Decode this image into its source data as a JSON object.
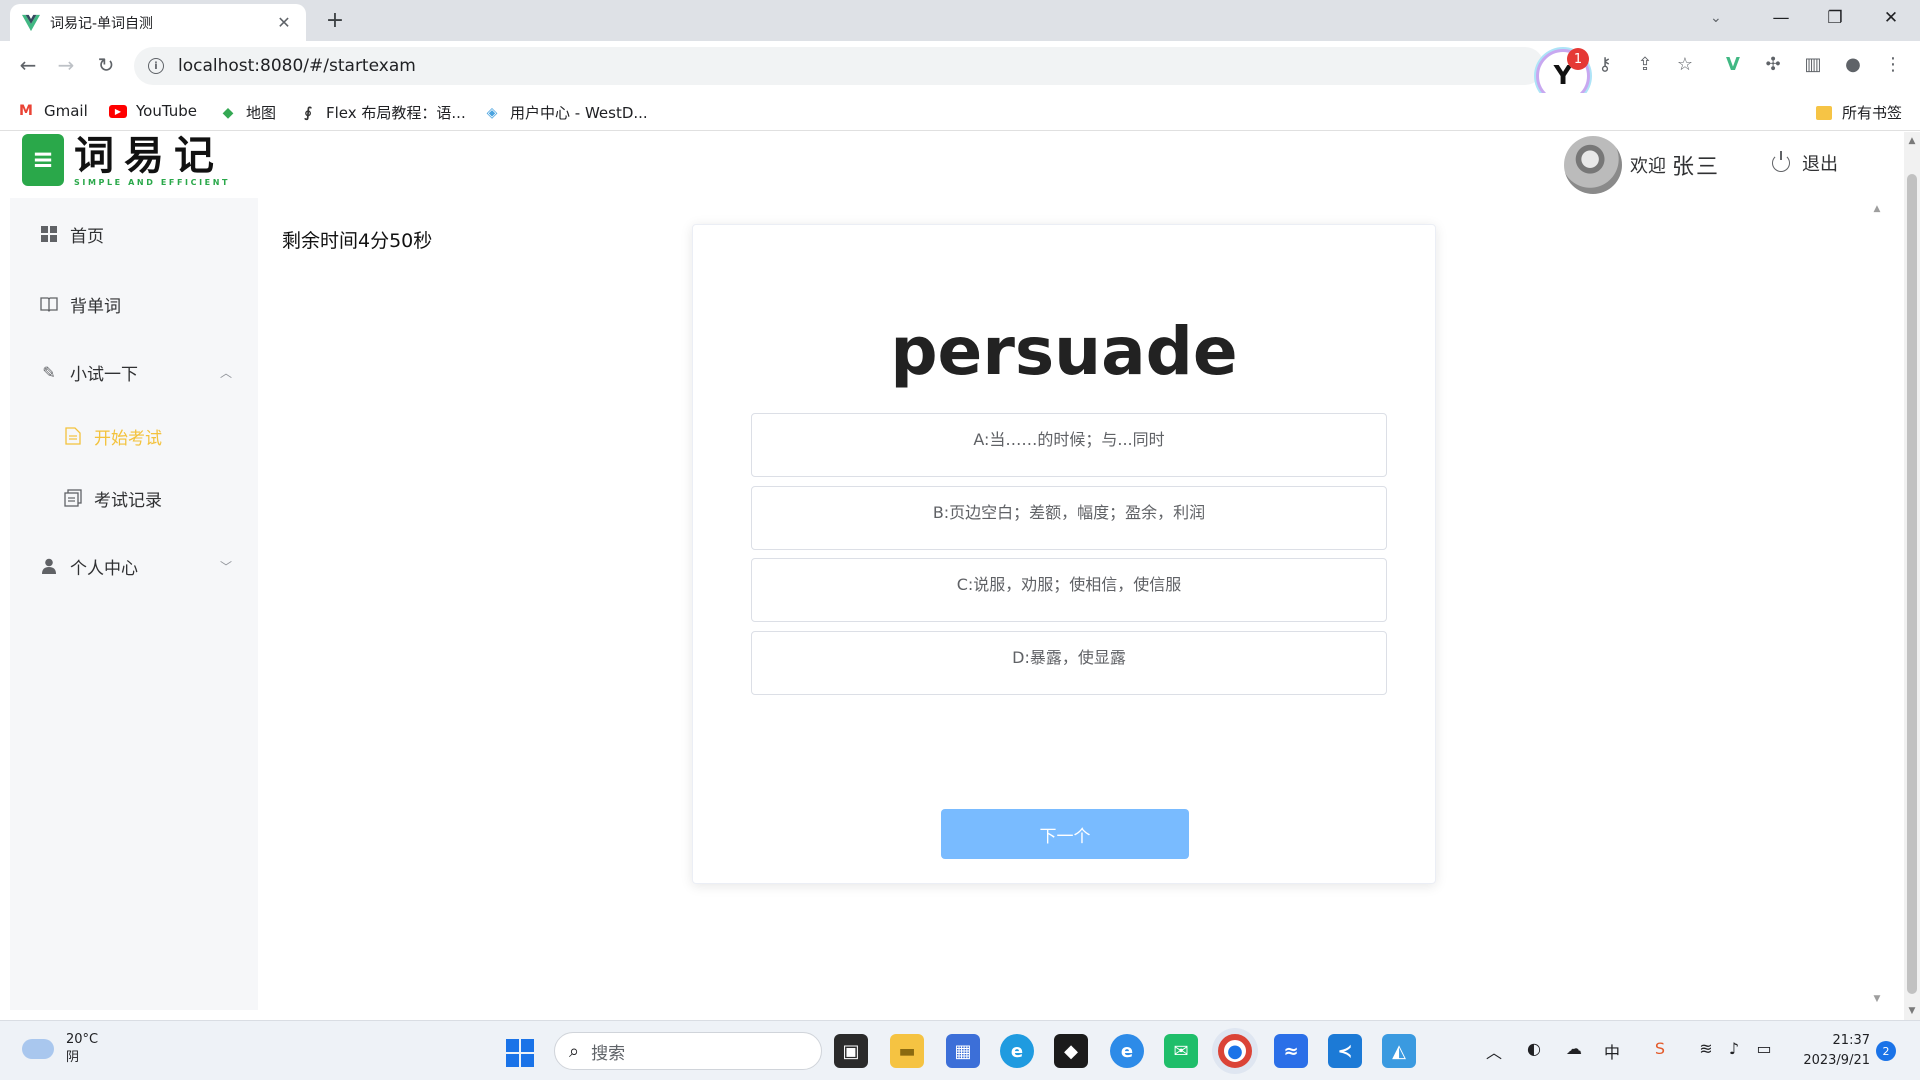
{
  "browser": {
    "tab_title": "词易记-单词自测",
    "url": "localhost:8080/#/startexam",
    "extension_badge_count": "1",
    "bookmarks": [
      {
        "label": "Gmail",
        "icon": "gmail-icon"
      },
      {
        "label": "YouTube",
        "icon": "youtube-icon"
      },
      {
        "label": "地图",
        "icon": "maps-icon"
      },
      {
        "label": "Flex 布局教程：语...",
        "icon": "flex-icon"
      },
      {
        "label": "用户中心 - WestD...",
        "icon": "westd-icon"
      }
    ],
    "all_bookmarks_label": "所有书签"
  },
  "header": {
    "logo_cn": "词易记",
    "logo_en": "SIMPLE AND EFFICIENT",
    "welcome": "欢迎",
    "username": "张三",
    "logout": "退出"
  },
  "sidebar": {
    "items": [
      {
        "label": "首页",
        "icon": "grid-icon"
      },
      {
        "label": "背单词",
        "icon": "book-icon"
      },
      {
        "label": "小试一下",
        "icon": "pencil-icon",
        "expanded": true
      },
      {
        "label": "开始考试",
        "icon": "document-icon",
        "active": true
      },
      {
        "label": "考试记录",
        "icon": "records-icon"
      },
      {
        "label": "个人中心",
        "icon": "user-icon",
        "expanded": false
      }
    ]
  },
  "exam": {
    "timer": "剩余时间4分50秒",
    "word": "persuade",
    "options": [
      "A:当……的时候；与...同时",
      "B:页边空白；差额，幅度；盈余，利润",
      "C:说服，劝服；使相信，使信服",
      "D:暴露，使显露"
    ],
    "next_label": "下一个"
  },
  "taskbar": {
    "temperature": "20°C",
    "weather": "阴",
    "search_placeholder": "搜索",
    "time": "21:37",
    "date": "2023/9/21",
    "notification_count": "2",
    "ime": "中"
  },
  "colors": {
    "accent_active": "#f3c23c",
    "button_primary_disabled": "#79bbff",
    "brand_green": "#2aa84a"
  }
}
